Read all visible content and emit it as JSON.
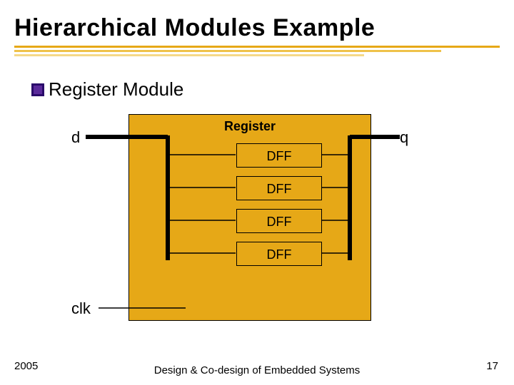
{
  "title": "Hierarchical Modules Example",
  "bullet": {
    "text": "Register Module"
  },
  "diagram": {
    "module_label": "Register",
    "ports": {
      "d": "d",
      "q": "q",
      "clk": "clk"
    },
    "dff_labels": [
      "DFF",
      "DFF",
      "DFF",
      "DFF"
    ]
  },
  "footer": {
    "year": "2005",
    "center": "Design & Co-design of Embedded Systems",
    "page": "17"
  }
}
